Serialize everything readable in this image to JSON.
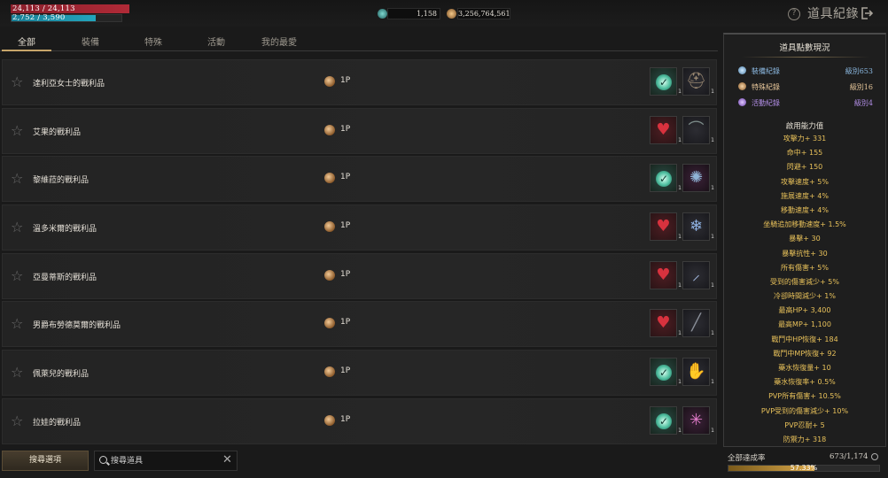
{
  "status": {
    "hp_text": "24,113 / 24,113",
    "mp_text": "2,752 / 3,590",
    "hp_fraction": 1.0,
    "mp_fraction": 0.7666
  },
  "currency": {
    "gem_icon": "gem-icon",
    "gem_value": "1,158",
    "coin_icon": "coin-icon",
    "coin_value": "3,256,764,561"
  },
  "header": {
    "title": "道具紀錄",
    "help_icon": "help-icon",
    "exit_icon": "exit-icon"
  },
  "tabs": [
    {
      "label": "全部",
      "active": true
    },
    {
      "label": "裝備",
      "active": false
    },
    {
      "label": "特殊",
      "active": false
    },
    {
      "label": "活動",
      "active": false
    },
    {
      "label": "我的最愛",
      "active": false
    }
  ],
  "items": [
    {
      "name": "達利亞女士的戰利品",
      "points": "1P",
      "slots": [
        {
          "icon": "check-icon",
          "style": "green",
          "count": "1"
        },
        {
          "icon": "helmet-icon",
          "style": "dark",
          "count": "1"
        }
      ]
    },
    {
      "name": "艾果的戰利品",
      "points": "1P",
      "slots": [
        {
          "icon": "armor-icon",
          "style": "red",
          "count": "1"
        },
        {
          "icon": "claw-icon",
          "style": "dark",
          "count": "1"
        }
      ]
    },
    {
      "name": "黎維菈的戰利品",
      "points": "1P",
      "slots": [
        {
          "icon": "check-icon",
          "style": "green",
          "count": "1"
        },
        {
          "icon": "orb-icon",
          "style": "purple",
          "count": "1"
        }
      ]
    },
    {
      "name": "溫多米爾的戰利品",
      "points": "1P",
      "slots": [
        {
          "icon": "armor-icon",
          "style": "red",
          "count": "1"
        },
        {
          "icon": "crystal-icon",
          "style": "dark",
          "count": "1"
        }
      ]
    },
    {
      "name": "亞曼蒂斯的戰利品",
      "points": "1P",
      "slots": [
        {
          "icon": "armor-icon",
          "style": "red",
          "count": "1"
        },
        {
          "icon": "blade-icon",
          "style": "dark",
          "count": "1"
        }
      ]
    },
    {
      "name": "男爵布勞德莫爾的戰利品",
      "points": "1P",
      "slots": [
        {
          "icon": "armor-icon",
          "style": "red",
          "count": "1"
        },
        {
          "icon": "spear-icon",
          "style": "dark",
          "count": "1"
        }
      ]
    },
    {
      "name": "佩萊兒的戰利品",
      "points": "1P",
      "slots": [
        {
          "icon": "check-icon",
          "style": "green",
          "count": "1"
        },
        {
          "icon": "gauntlet-icon",
          "style": "dark",
          "count": "1"
        }
      ]
    },
    {
      "name": "拉娃的戰利品",
      "points": "1P",
      "slots": [
        {
          "icon": "check-icon",
          "style": "green",
          "count": "1"
        },
        {
          "icon": "spider-icon",
          "style": "purple",
          "count": "1"
        }
      ]
    }
  ],
  "bottom": {
    "search_button": "搜尋選項",
    "search_placeholder": "搜尋道具"
  },
  "panel": {
    "title": "道具點數現況",
    "records": [
      {
        "label": "裝備紀錄",
        "level": "級別653"
      },
      {
        "label": "特殊紀錄",
        "level": "級別16"
      },
      {
        "label": "活動紀錄",
        "level": "級別4"
      }
    ],
    "stats_title": "啟用能力值",
    "stats": [
      "攻擊力+ 331",
      "命中+ 155",
      "閃避+ 150",
      "攻擊速度+ 5%",
      "施展速度+ 4%",
      "移動速度+ 4%",
      "坐騎追加移動速度+ 1.5%",
      "暴擊+ 30",
      "暴擊抗性+ 30",
      "所有傷害+ 5%",
      "受到的傷害減少+ 5%",
      "冷卻時間減少+ 1%",
      "最高HP+ 3,400",
      "最高MP+ 1,100",
      "戰鬥中HP恢復+ 184",
      "戰鬥中MP恢復+ 92",
      "藥水恢復量+ 10",
      "藥水恢復率+ 0.5%",
      "PVP所有傷害+ 10.5%",
      "PVP受到的傷害減少+ 10%",
      "PVP忍耐+ 5",
      "防禦力+ 318"
    ],
    "progress_label": "全部達成率",
    "progress_value": "673/1,174",
    "progress_pct": "57.33%",
    "progress_fraction": 0.5733
  },
  "colors": {
    "accent": "#c7a56a",
    "stat_text": "#e8c15a",
    "hp": "#b02a37",
    "mp": "#22a5bd"
  }
}
